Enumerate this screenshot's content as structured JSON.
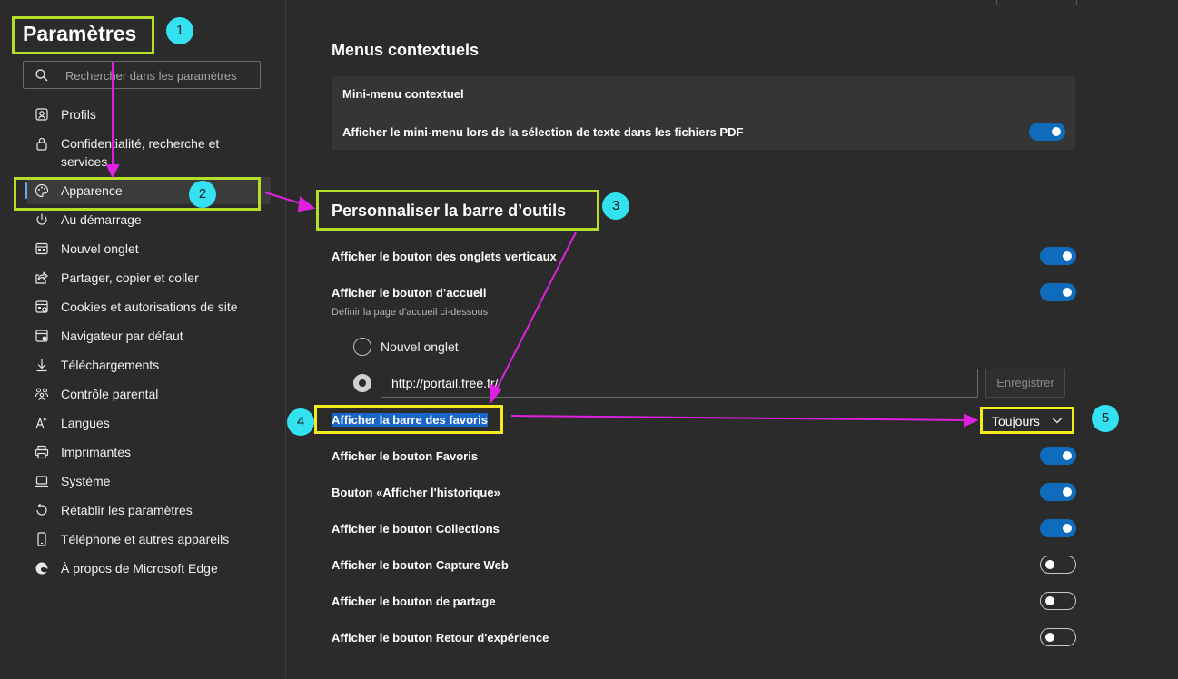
{
  "sidebar": {
    "title": "Paramètres",
    "search_placeholder": "Rechercher dans les paramètres",
    "items": [
      {
        "label": "Profils",
        "icon": "profile-icon"
      },
      {
        "label": "Confidentialité, recherche et services",
        "icon": "lock-icon"
      },
      {
        "label": "Apparence",
        "icon": "palette-icon",
        "selected": true
      },
      {
        "label": "Au démarrage",
        "icon": "power-icon"
      },
      {
        "label": "Nouvel onglet",
        "icon": "new-tab-icon"
      },
      {
        "label": "Partager, copier et coller",
        "icon": "share-icon"
      },
      {
        "label": "Cookies et autorisations de site",
        "icon": "cookie-icon"
      },
      {
        "label": "Navigateur par défaut",
        "icon": "browser-icon"
      },
      {
        "label": "Téléchargements",
        "icon": "download-icon"
      },
      {
        "label": "Contrôle parental",
        "icon": "family-icon"
      },
      {
        "label": "Langues",
        "icon": "language-icon"
      },
      {
        "label": "Imprimantes",
        "icon": "printer-icon"
      },
      {
        "label": "Système",
        "icon": "laptop-icon"
      },
      {
        "label": "Rétablir les paramètres",
        "icon": "reset-icon"
      },
      {
        "label": "Téléphone et autres appareils",
        "icon": "phone-icon"
      },
      {
        "label": "À propos de Microsoft Edge",
        "icon": "edge-icon"
      }
    ]
  },
  "context_menus": {
    "heading": "Menus contextuels",
    "mini_menu_title": "Mini-menu contextuel",
    "mini_menu_pdf_label": "Afficher le mini-menu lors de la sélection de texte dans les fichiers PDF",
    "mini_menu_pdf_on": true
  },
  "toolbar": {
    "heading": "Personnaliser la barre d’outils",
    "settings": [
      {
        "label": "Afficher le bouton des onglets verticaux",
        "on": true
      },
      {
        "label": "Afficher le bouton d’accueil",
        "on": true
      }
    ],
    "home_description": "Définir la page d'accueil ci-dessous",
    "radio_new_tab": "Nouvel onglet",
    "home_url": "http://portail.free.fr/",
    "save_label": "Enregistrer",
    "favorites_bar_label": "Afficher la barre des favoris",
    "favorites_bar_value": "Toujours",
    "more_settings": [
      {
        "label": "Afficher le bouton Favoris",
        "on": true
      },
      {
        "label": "Bouton «Afficher l'historique»",
        "on": true
      },
      {
        "label": "Afficher le bouton Collections",
        "on": true
      },
      {
        "label": "Afficher le bouton Capture Web",
        "on": false
      },
      {
        "label": "Afficher le bouton de partage",
        "on": false
      },
      {
        "label": "Afficher le bouton Retour d'expérience",
        "on": false
      }
    ]
  },
  "annotations": {
    "badges": [
      "1",
      "2",
      "3",
      "4",
      "5"
    ],
    "highlight_green": "#b4de2a",
    "highlight_yellow": "#f5eb1a",
    "badge_color": "#33e1f0",
    "arrow_color": "#e020e0"
  },
  "colors": {
    "background": "#2b2b2b",
    "accent": "#0f6cbd"
  }
}
